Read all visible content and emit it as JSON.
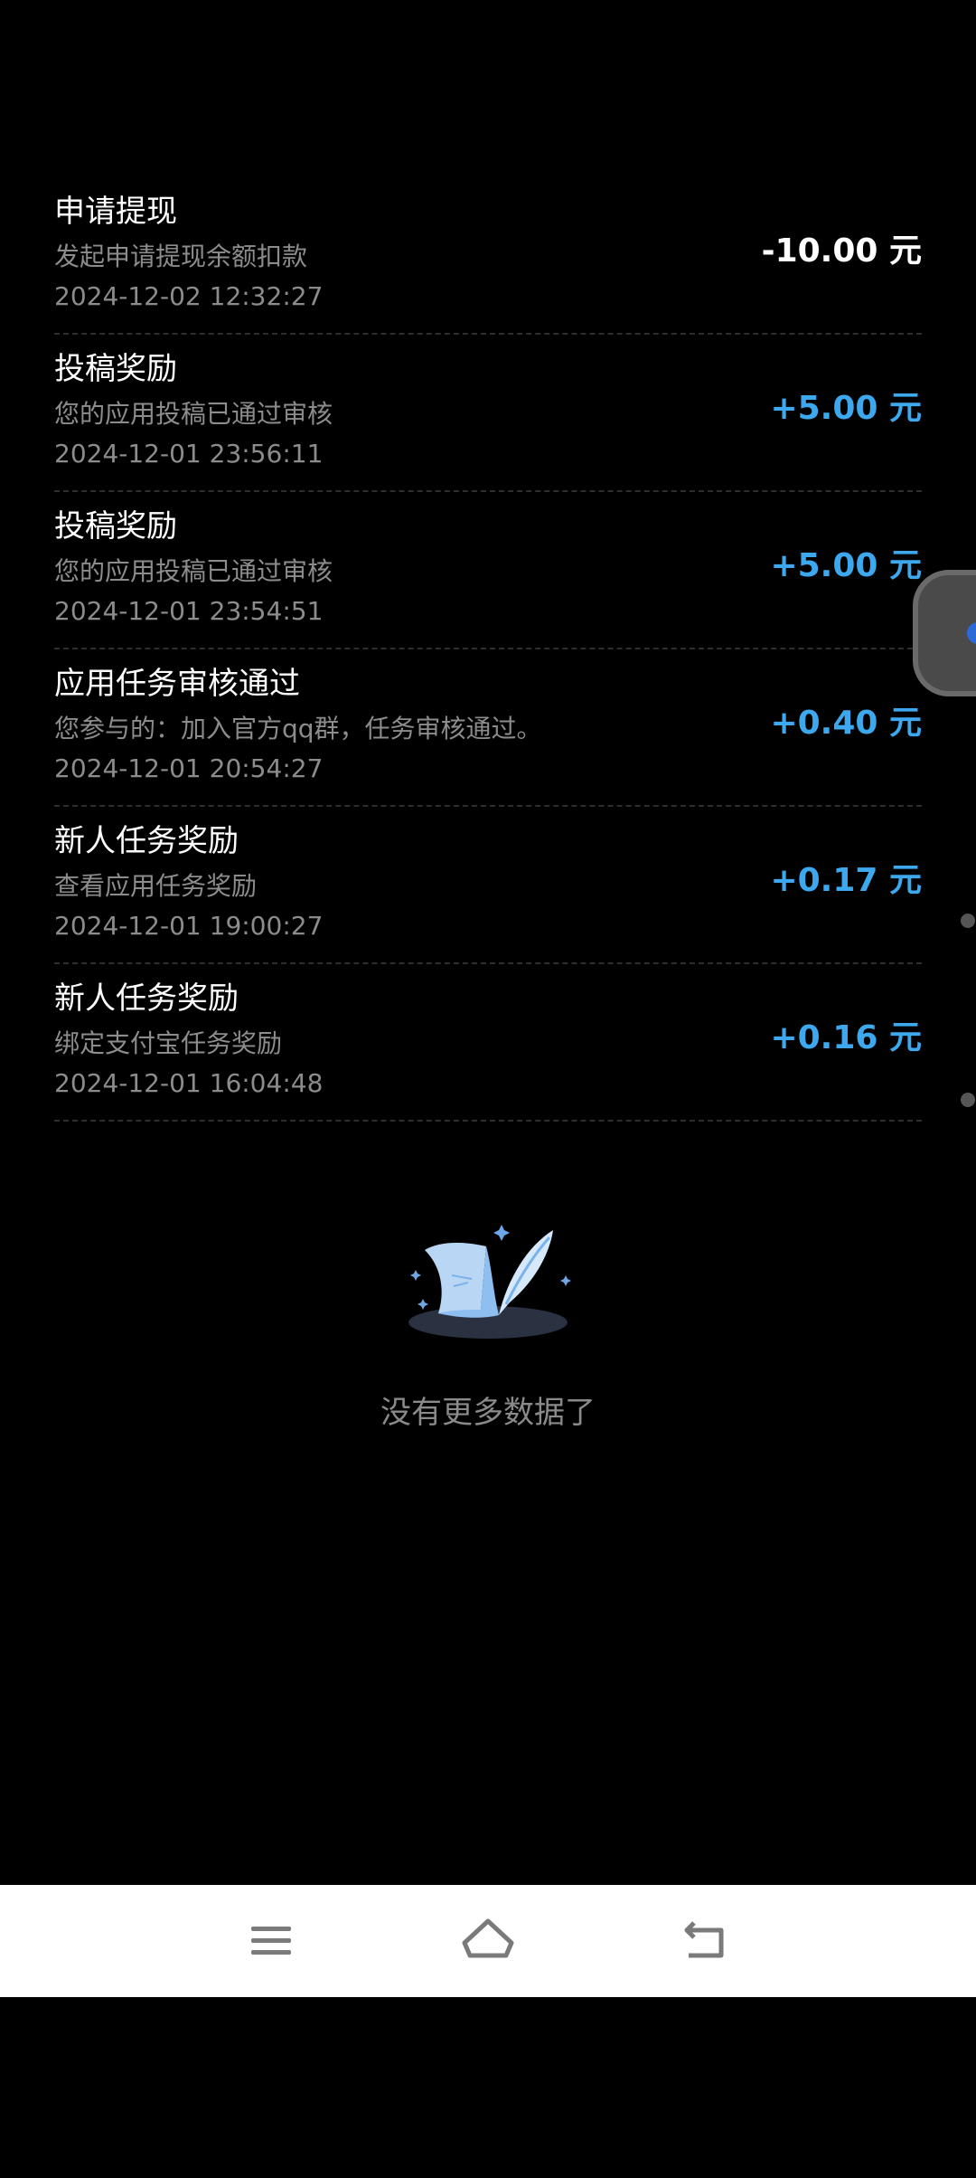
{
  "transactions": [
    {
      "title": "申请提现",
      "desc": "发起申请提现余额扣款",
      "time": "2024-12-02 12:32:27",
      "amount": "-10.00 元"
    },
    {
      "title": "投稿奖励",
      "desc": "您的应用投稿已通过审核",
      "time": "2024-12-01 23:56:11",
      "amount": "+5.00 元"
    },
    {
      "title": "投稿奖励",
      "desc": "您的应用投稿已通过审核",
      "time": "2024-12-01 23:54:51",
      "amount": "+5.00 元"
    },
    {
      "title": "应用任务审核通过",
      "desc": "您参与的：加入官方qq群，任务审核通过。",
      "time": "2024-12-01 20:54:27",
      "amount": "+0.40 元"
    },
    {
      "title": "新人任务奖励",
      "desc": "查看应用任务奖励",
      "time": "2024-12-01 19:00:27",
      "amount": "+0.17 元"
    },
    {
      "title": "新人任务奖励",
      "desc": "绑定支付宝任务奖励",
      "time": "2024-12-01 16:04:48",
      "amount": "+0.16 元"
    }
  ],
  "empty_state": {
    "text": "没有更多数据了",
    "icon": "scroll-quill-icon"
  },
  "nav": {
    "menu_icon": "menu-icon",
    "home_icon": "home-icon",
    "back_icon": "back-icon"
  },
  "colors": {
    "background": "#000000",
    "positive_amount": "#3ea8ef",
    "negative_amount": "#ffffff",
    "secondary_text": "#8c8c8c"
  }
}
